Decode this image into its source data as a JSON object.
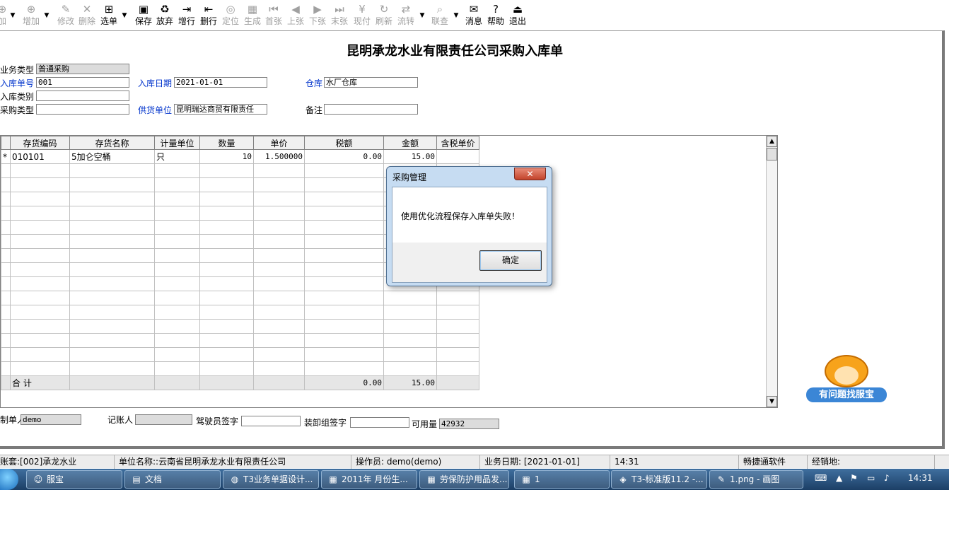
{
  "toolbar": {
    "buttons": [
      {
        "label": "加",
        "icon": "⊕",
        "name": "add-partial-button",
        "disabled": true
      },
      {
        "label": "增加",
        "icon": "⊕",
        "name": "add-button",
        "disabled": true
      },
      {
        "label": "修改",
        "icon": "✎",
        "name": "edit-button",
        "disabled": true
      },
      {
        "label": "删除",
        "icon": "✕",
        "name": "delete-button",
        "disabled": true
      },
      {
        "label": "选单",
        "icon": "⊞",
        "name": "select-order-button",
        "disabled": false
      },
      {
        "label": "保存",
        "icon": "▣",
        "name": "save-button",
        "disabled": false
      },
      {
        "label": "放弃",
        "icon": "♻",
        "name": "abandon-button",
        "disabled": false
      },
      {
        "label": "增行",
        "icon": "⇥",
        "name": "add-row-button",
        "disabled": false
      },
      {
        "label": "删行",
        "icon": "⇤",
        "name": "delete-row-button",
        "disabled": false
      },
      {
        "label": "定位",
        "icon": "◎",
        "name": "locate-button",
        "disabled": true
      },
      {
        "label": "生成",
        "icon": "▦",
        "name": "generate-button",
        "disabled": true
      },
      {
        "label": "首张",
        "icon": "⏮",
        "name": "first-button",
        "disabled": true
      },
      {
        "label": "上张",
        "icon": "◀",
        "name": "previous-button",
        "disabled": true
      },
      {
        "label": "下张",
        "icon": "▶",
        "name": "next-button",
        "disabled": true
      },
      {
        "label": "末张",
        "icon": "⏭",
        "name": "last-button",
        "disabled": true
      },
      {
        "label": "现付",
        "icon": "¥",
        "name": "pay-now-button",
        "disabled": true
      },
      {
        "label": "刷新",
        "icon": "↻",
        "name": "refresh-button",
        "disabled": true
      },
      {
        "label": "流转",
        "icon": "⇄",
        "name": "flow-button",
        "disabled": true
      },
      {
        "label": "联查",
        "icon": "⌕",
        "name": "linked-query-button",
        "disabled": true
      },
      {
        "label": "消息",
        "icon": "✉",
        "name": "message-button",
        "disabled": false
      },
      {
        "label": "帮助",
        "icon": "?",
        "name": "help-button",
        "disabled": false
      },
      {
        "label": "退出",
        "icon": "⏏",
        "name": "exit-button",
        "disabled": false
      }
    ]
  },
  "form": {
    "title": "昆明承龙水业有限责任公司采购入库单",
    "business_type_label": "业务类型",
    "business_type_value": "普通采购",
    "receipt_no_label": "入库单号",
    "receipt_no_value": "001",
    "receipt_date_label": "入库日期",
    "receipt_date_value": "2021-01-01",
    "warehouse_label": "仓库",
    "warehouse_value": "水厂仓库",
    "receipt_category_label": "入库类别",
    "purchase_type_label": "采购类型",
    "supplier_label": "供货单位",
    "supplier_value": "昆明瑞达商贸有限责任",
    "remark_label": "备注"
  },
  "grid": {
    "headers": [
      "存货编码",
      "存货名称",
      "计量单位",
      "数量",
      "单价",
      "税额",
      "金额",
      "含税单价"
    ],
    "rows": [
      {
        "marker": "*",
        "code": "010101",
        "name": "5加仑空桶",
        "unit": "只",
        "qty": "10",
        "price": "1.500000",
        "tax": "0.00",
        "amount": "15.00",
        "tax_price": ""
      }
    ],
    "sum_label": "合 计",
    "sum_tax": "0.00",
    "sum_amount": "15.00"
  },
  "footer_fields": {
    "maker_label": "制单人",
    "maker_value": "demo",
    "bookkeeper_label": "记账人",
    "driver_label": "驾驶员签字",
    "loader_label": "装卸组签字",
    "available_label": "可用量",
    "available_value": "42932"
  },
  "assistant": {
    "label": "有问题找服宝"
  },
  "status_bar": {
    "account": "账套:[002]承龙水业",
    "unit": "单位名称::云南省昆明承龙水业有限责任公司",
    "operator": "操作员: demo(demo)",
    "business_date": "业务日期: [2021-01-01]",
    "time": "14:31",
    "vendor": "畅捷通软件",
    "dealer": "经销地:"
  },
  "taskbar": {
    "items": [
      {
        "label": "服宝",
        "icon": "☺",
        "name": "taskbar-fubao"
      },
      {
        "label": "文档",
        "icon": "▤",
        "name": "taskbar-documents"
      },
      {
        "label": "T3业务单据设计...",
        "icon": "◍",
        "name": "taskbar-t3-designer"
      },
      {
        "label": "2011年 月份生...",
        "icon": "▦",
        "name": "taskbar-excel-monthly"
      },
      {
        "label": "劳保防护用品发...",
        "icon": "▦",
        "name": "taskbar-excel-protective"
      },
      {
        "label": "1",
        "icon": "▦",
        "name": "taskbar-excel-1"
      },
      {
        "label": "T3-标准版11.2 -...",
        "icon": "◈",
        "name": "taskbar-t3-standard"
      },
      {
        "label": "1.png - 画图",
        "icon": "✎",
        "name": "taskbar-paint"
      }
    ],
    "clock": "14:31"
  },
  "dialog": {
    "title": "采购管理",
    "message": "使用优化流程保存入库单失败！",
    "ok_label": "确定"
  }
}
